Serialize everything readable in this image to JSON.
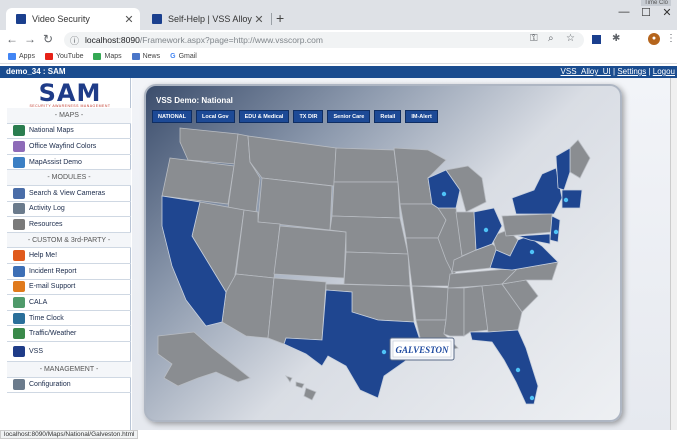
{
  "browser": {
    "tabs": [
      {
        "label": "Video Security",
        "active": true
      },
      {
        "label": "Self-Help | VSS Alloy",
        "active": false
      }
    ],
    "url_host": "localhost:8090",
    "url_path": "/Framework.aspx?page=http://www.vsscorp.com",
    "bookmarks": [
      "Apps",
      "YouTube",
      "Maps",
      "News",
      "Gmail"
    ],
    "tiny_corner_text": "Time Clo",
    "status_text": "localhost:8090/Maps/National/Galveston.html"
  },
  "appbar": {
    "left": "demo_34 :  SAM",
    "user": "VSS_Alloy_UI",
    "sep": " | ",
    "settings": "Settings",
    "logout": "Logou"
  },
  "sidebar": {
    "logo": "SAM",
    "logo_tagline": "SECURITY AWARENESS MANAGEMENT",
    "items": [
      {
        "label": "- MAPS -",
        "type": "section"
      },
      {
        "label": "National Maps",
        "icon": "map-icon",
        "color": "#2a7d4f"
      },
      {
        "label": "Office Wayfind Colors",
        "icon": "palette-icon",
        "color": "#8e6bb8"
      },
      {
        "label": "MapAssist Demo",
        "icon": "globe-icon",
        "color": "#3b7fc4"
      },
      {
        "label": "- MODULES -",
        "type": "section"
      },
      {
        "label": "Search & View Cameras",
        "icon": "camera-icon",
        "color": "#4a6da8"
      },
      {
        "label": "Activity Log",
        "icon": "log-icon",
        "color": "#6b7b8c"
      },
      {
        "label": "Resources",
        "icon": "tools-icon",
        "color": "#7a7a7a"
      },
      {
        "label": "- CUSTOM & 3rd-PARTY -",
        "type": "section"
      },
      {
        "label": "Help Me!",
        "icon": "help-icon",
        "color": "#e05a1c"
      },
      {
        "label": "Incident Report",
        "icon": "report-icon",
        "color": "#3d6fb6"
      },
      {
        "label": "E-mail Support",
        "icon": "email-icon",
        "color": "#e07a1c"
      },
      {
        "label": "CALA",
        "icon": "cala-icon",
        "color": "#4f9a6a"
      },
      {
        "label": "Time Clock",
        "icon": "clock-icon",
        "color": "#2a6f9a"
      },
      {
        "label": "Traffic/Weather",
        "icon": "weather-icon",
        "color": "#3a8a4a"
      },
      {
        "label": "VSS",
        "icon": "vss-icon",
        "color": "#1f3c88"
      },
      {
        "label": "- MANAGEMENT -",
        "type": "section"
      },
      {
        "label": "Configuration",
        "icon": "config-icon",
        "color": "#6b7b8c"
      }
    ]
  },
  "panel": {
    "title": "VSS Demo: National",
    "buttons": [
      "NATIONAL",
      "Local Gov",
      "EDU & Medical",
      "TX DIR",
      "Senior Care",
      "Retail",
      "IM-Alert"
    ],
    "callout": "GALVESTON"
  },
  "colors": {
    "highlight_state": "#1f4690",
    "base_state": "#8a8d91",
    "appbar": "#1a4c8f"
  }
}
